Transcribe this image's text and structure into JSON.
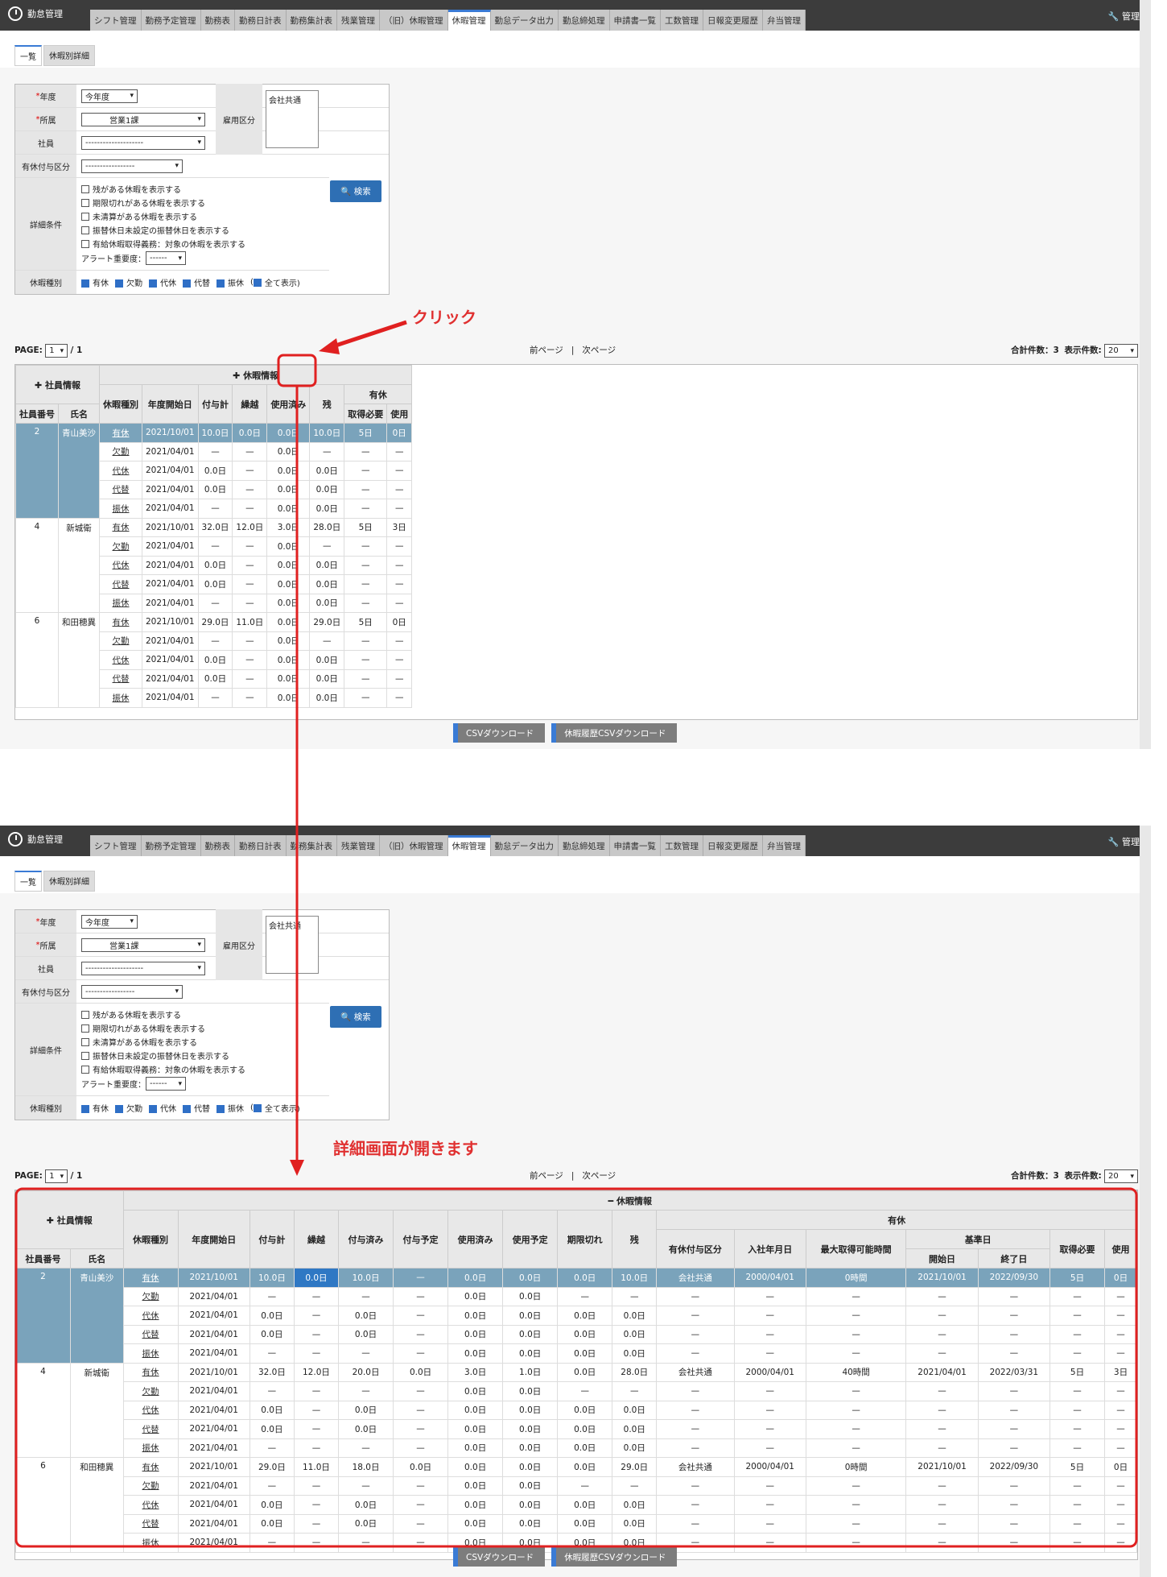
{
  "app_title": "勤怠管理",
  "admin_label": "管理",
  "tabs": [
    "シフト管理",
    "勤務予定管理",
    "勤務表",
    "勤務日計表",
    "勤務集計表",
    "残業管理",
    "（旧）休暇管理",
    "休暇管理",
    "勤怠データ出力",
    "勤怠締処理",
    "申請書一覧",
    "工数管理",
    "日報変更履歴",
    "弁当管理"
  ],
  "active_tab": "休暇管理",
  "subtabs": [
    "一覧",
    "休暇別詳細"
  ],
  "form": {
    "nendo_label": "年度",
    "nendo_value": "今年度",
    "shozoku_label": "所属",
    "shozoku_value": "営業1課",
    "shain_label": "社員",
    "shain_value": "--------------------",
    "yuukyu_label": "有休付与区分",
    "yuukyu_value": "-----------------",
    "koyo_label": "雇用区分",
    "koyo_value": "会社共通",
    "detail_label": "詳細条件",
    "checks": [
      "残がある休暇を表示する",
      "期限切れがある休暇を表示する",
      "未清算がある休暇を表示する",
      "振替休日未設定の振替休日を表示する",
      "有給休暇取得義務：対象の休暇を表示する"
    ],
    "alert_label": "アラート重要度：",
    "alert_value": "------",
    "kyuka_label": "休暇種別",
    "kyuka_types": [
      "有休",
      "欠勤",
      "代休",
      "代替",
      "振休"
    ],
    "show_all": "全て表示)",
    "paren": "(",
    "search_label": "検索"
  },
  "pager": {
    "page_label": "PAGE:",
    "page_value": "1",
    "page_total": "/ 1",
    "prev": "前ページ",
    "sep": "|",
    "next": "次ページ",
    "total_label": "合計件数：3",
    "per_page_label": "表示件数:",
    "per_page_value": "20"
  },
  "headers": {
    "shain_info": "社員情報",
    "kyuka_info": "休暇情報",
    "no": "社員番号",
    "name": "氏名",
    "type": "休暇種別",
    "start": "年度開始日",
    "fuyo": "付与計",
    "kurikoshi": "繰越",
    "used": "使用済み",
    "zan": "残",
    "yukyu": "有休",
    "need": "取得必要",
    "use": "使用",
    "fuyozumi": "付与済み",
    "fuyoyotei": "付与予定",
    "useyotei": "使用予定",
    "expired": "期限切れ",
    "kubun": "有休付与区分",
    "nyusha": "入社年月日",
    "maxtime": "最大取得可能時間",
    "kijun": "基準日",
    "kstart": "開始日",
    "kend": "終了日"
  },
  "employees": [
    {
      "no": "2",
      "name": "青山美沙",
      "rows": [
        {
          "type": "有休",
          "start": "2021/10/01",
          "fuyo": "10.0日",
          "kuri": "0.0日",
          "fuyozumi": "10.0日",
          "fuyoyotei": "—",
          "used": "0.0日",
          "useyotei": "0.0日",
          "expired": "0.0日",
          "zan": "10.0日",
          "kubun": "会社共通",
          "nyusha": "2000/04/01",
          "maxtime": "0時間",
          "kstart": "2021/10/01",
          "kend": "2022/09/30",
          "need": "5日",
          "use": "0日"
        },
        {
          "type": "欠勤",
          "start": "2021/04/01",
          "fuyo": "—",
          "kuri": "—",
          "fuyozumi": "—",
          "fuyoyotei": "—",
          "used": "0.0日",
          "useyotei": "0.0日",
          "expired": "—",
          "zan": "—",
          "kubun": "—",
          "nyusha": "—",
          "maxtime": "—",
          "kstart": "—",
          "kend": "—",
          "need": "—",
          "use": "—"
        },
        {
          "type": "代休",
          "start": "2021/04/01",
          "fuyo": "0.0日",
          "kuri": "—",
          "fuyozumi": "0.0日",
          "fuyoyotei": "—",
          "used": "0.0日",
          "useyotei": "0.0日",
          "expired": "0.0日",
          "zan": "0.0日",
          "kubun": "—",
          "nyusha": "—",
          "maxtime": "—",
          "kstart": "—",
          "kend": "—",
          "need": "—",
          "use": "—"
        },
        {
          "type": "代替",
          "start": "2021/04/01",
          "fuyo": "0.0日",
          "kuri": "—",
          "fuyozumi": "0.0日",
          "fuyoyotei": "—",
          "used": "0.0日",
          "useyotei": "0.0日",
          "expired": "0.0日",
          "zan": "0.0日",
          "kubun": "—",
          "nyusha": "—",
          "maxtime": "—",
          "kstart": "—",
          "kend": "—",
          "need": "—",
          "use": "—"
        },
        {
          "type": "振休",
          "start": "2021/04/01",
          "fuyo": "—",
          "kuri": "—",
          "fuyozumi": "—",
          "fuyoyotei": "—",
          "used": "0.0日",
          "useyotei": "0.0日",
          "expired": "0.0日",
          "zan": "0.0日",
          "kubun": "—",
          "nyusha": "—",
          "maxtime": "—",
          "kstart": "—",
          "kend": "—",
          "need": "—",
          "use": "—"
        }
      ]
    },
    {
      "no": "4",
      "name": "新城衛",
      "rows": [
        {
          "type": "有休",
          "start": "2021/10/01",
          "fuyo": "32.0日",
          "kuri": "12.0日",
          "fuyozumi": "20.0日",
          "fuyoyotei": "0.0日",
          "used": "3.0日",
          "useyotei": "1.0日",
          "expired": "0.0日",
          "zan": "28.0日",
          "kubun": "会社共通",
          "nyusha": "2000/04/01",
          "maxtime": "40時間",
          "kstart": "2021/04/01",
          "kend": "2022/03/31",
          "need": "5日",
          "use": "3日"
        },
        {
          "type": "欠勤",
          "start": "2021/04/01",
          "fuyo": "—",
          "kuri": "—",
          "fuyozumi": "—",
          "fuyoyotei": "—",
          "used": "0.0日",
          "useyotei": "0.0日",
          "expired": "—",
          "zan": "—",
          "kubun": "—",
          "nyusha": "—",
          "maxtime": "—",
          "kstart": "—",
          "kend": "—",
          "need": "—",
          "use": "—"
        },
        {
          "type": "代休",
          "start": "2021/04/01",
          "fuyo": "0.0日",
          "kuri": "—",
          "fuyozumi": "0.0日",
          "fuyoyotei": "—",
          "used": "0.0日",
          "useyotei": "0.0日",
          "expired": "0.0日",
          "zan": "0.0日",
          "kubun": "—",
          "nyusha": "—",
          "maxtime": "—",
          "kstart": "—",
          "kend": "—",
          "need": "—",
          "use": "—"
        },
        {
          "type": "代替",
          "start": "2021/04/01",
          "fuyo": "0.0日",
          "kuri": "—",
          "fuyozumi": "0.0日",
          "fuyoyotei": "—",
          "used": "0.0日",
          "useyotei": "0.0日",
          "expired": "0.0日",
          "zan": "0.0日",
          "kubun": "—",
          "nyusha": "—",
          "maxtime": "—",
          "kstart": "—",
          "kend": "—",
          "need": "—",
          "use": "—"
        },
        {
          "type": "振休",
          "start": "2021/04/01",
          "fuyo": "—",
          "kuri": "—",
          "fuyozumi": "—",
          "fuyoyotei": "—",
          "used": "0.0日",
          "useyotei": "0.0日",
          "expired": "0.0日",
          "zan": "0.0日",
          "kubun": "—",
          "nyusha": "—",
          "maxtime": "—",
          "kstart": "—",
          "kend": "—",
          "need": "—",
          "use": "—"
        }
      ]
    },
    {
      "no": "6",
      "name": "和田穂異",
      "rows": [
        {
          "type": "有休",
          "start": "2021/10/01",
          "fuyo": "29.0日",
          "kuri": "11.0日",
          "fuyozumi": "18.0日",
          "fuyoyotei": "0.0日",
          "used": "0.0日",
          "useyotei": "0.0日",
          "expired": "0.0日",
          "zan": "29.0日",
          "kubun": "会社共通",
          "nyusha": "2000/04/01",
          "maxtime": "0時間",
          "kstart": "2021/10/01",
          "kend": "2022/09/30",
          "need": "5日",
          "use": "0日"
        },
        {
          "type": "欠勤",
          "start": "2021/04/01",
          "fuyo": "—",
          "kuri": "—",
          "fuyozumi": "—",
          "fuyoyotei": "—",
          "used": "0.0日",
          "useyotei": "0.0日",
          "expired": "—",
          "zan": "—",
          "kubun": "—",
          "nyusha": "—",
          "maxtime": "—",
          "kstart": "—",
          "kend": "—",
          "need": "—",
          "use": "—"
        },
        {
          "type": "代休",
          "start": "2021/04/01",
          "fuyo": "0.0日",
          "kuri": "—",
          "fuyozumi": "0.0日",
          "fuyoyotei": "—",
          "used": "0.0日",
          "useyotei": "0.0日",
          "expired": "0.0日",
          "zan": "0.0日",
          "kubun": "—",
          "nyusha": "—",
          "maxtime": "—",
          "kstart": "—",
          "kend": "—",
          "need": "—",
          "use": "—"
        },
        {
          "type": "代替",
          "start": "2021/04/01",
          "fuyo": "0.0日",
          "kuri": "—",
          "fuyozumi": "0.0日",
          "fuyoyotei": "—",
          "used": "0.0日",
          "useyotei": "0.0日",
          "expired": "0.0日",
          "zan": "0.0日",
          "kubun": "—",
          "nyusha": "—",
          "maxtime": "—",
          "kstart": "—",
          "kend": "—",
          "need": "—",
          "use": "—"
        },
        {
          "type": "振休",
          "start": "2021/04/01",
          "fuyo": "—",
          "kuri": "—",
          "fuyozumi": "—",
          "fuyoyotei": "—",
          "used": "0.0日",
          "useyotei": "0.0日",
          "expired": "0.0日",
          "zan": "0.0日",
          "kubun": "—",
          "nyusha": "—",
          "maxtime": "—",
          "kstart": "—",
          "kend": "—",
          "need": "—",
          "use": "—"
        }
      ]
    }
  ],
  "buttons": {
    "csv": "CSVダウンロード",
    "history_csv": "休暇履歴CSVダウンロード"
  },
  "annotations": {
    "click": "クリック",
    "opened": "詳細画面が開きます"
  },
  "colors": {
    "highlight_row": "#7aa3bb",
    "accent": "#2e6fb4",
    "annotation": "#e02020"
  }
}
